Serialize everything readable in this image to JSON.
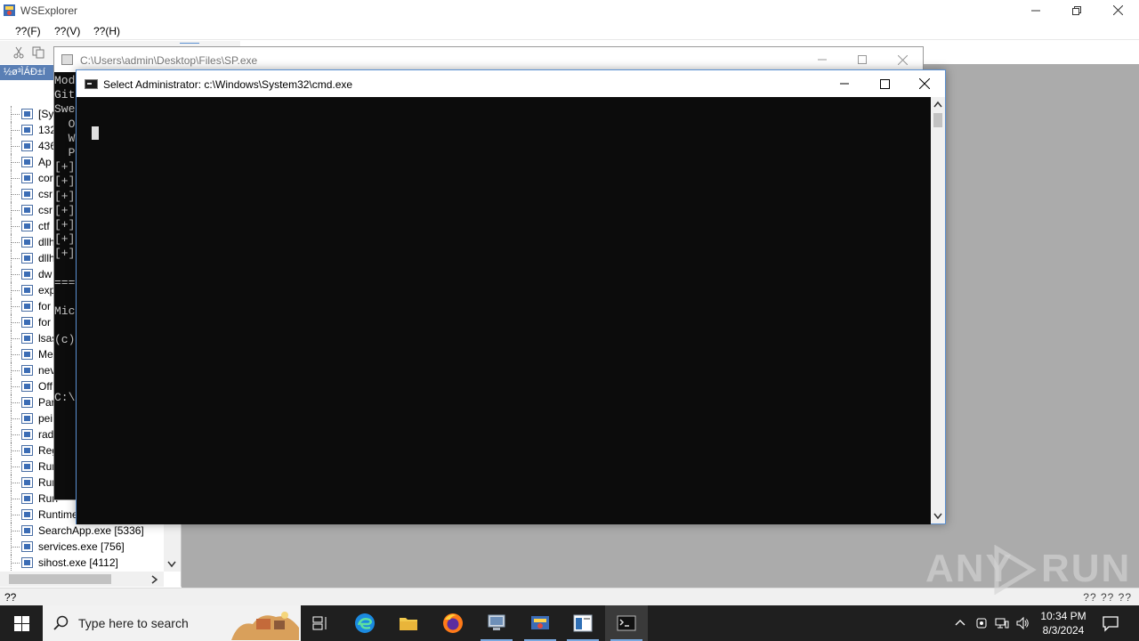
{
  "wsexplorer": {
    "title": "WSExplorer",
    "menu": [
      "??(F)",
      "??(V)",
      "??(H)"
    ],
    "tree_label": "½ø³ÌÁÐ±í",
    "tree_items": [
      "[Sy",
      "132",
      "436",
      "Ap",
      "cor",
      "csr",
      "csr",
      "ctf",
      "dllh",
      "dllh",
      "dw",
      "exp",
      "for",
      "for",
      "lsas",
      "Me",
      "nev",
      "Off",
      "Par",
      "pei",
      "rad",
      "Reg",
      "Run",
      "Run",
      "Run",
      "Runtime",
      "SearchApp.exe [5336]",
      "services.exe [756]",
      "sihost.exe [4112]"
    ],
    "status_left": "??",
    "status_right": "?? ?? ??"
  },
  "sp_window": {
    "title": "C:\\Users\\admin\\Desktop\\Files\\SP.exe",
    "visible_lines": [
      "Mod",
      "Git",
      "Swe",
      "  O",
      "  W",
      "  P",
      "[+]",
      "[+]",
      "[+]",
      "[+]",
      "[+]",
      "[+]",
      "[+]",
      "",
      "===",
      "",
      "Mic",
      "",
      "(c)",
      "",
      "",
      "",
      "C:\\"
    ]
  },
  "cmd_window": {
    "title": "Select Administrator: c:\\Windows\\System32\\cmd.exe"
  },
  "watermark": {
    "text_a": "ANY",
    "text_b": "RUN"
  },
  "taskbar": {
    "search_placeholder": "Type here to search",
    "clock_time": "10:34 PM",
    "clock_date": "8/3/2024"
  },
  "colors": {
    "console_bg": "#0c0c0c",
    "taskbar_bg": "#1f1f1f",
    "desktop_grey": "#ababab"
  }
}
